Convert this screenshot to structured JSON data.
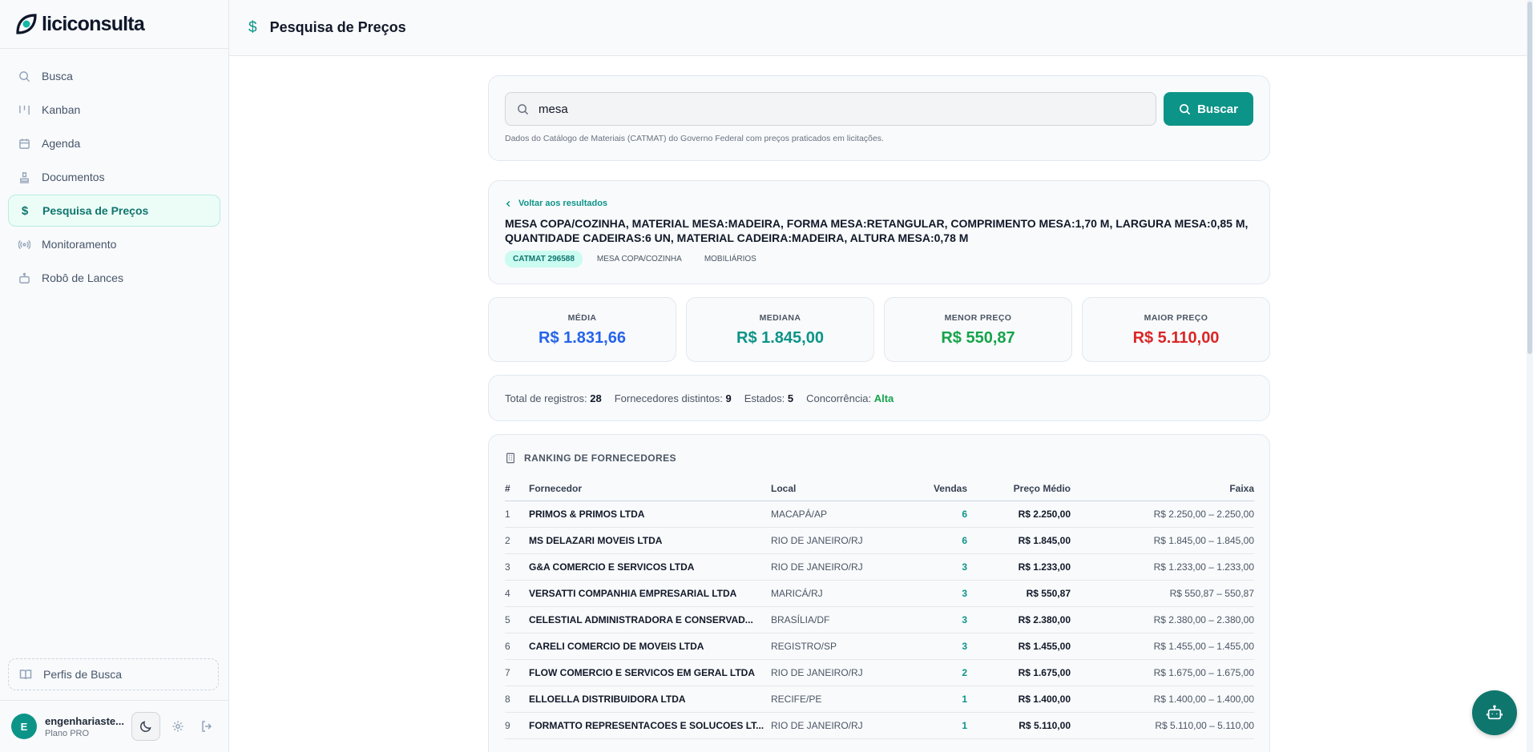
{
  "app": {
    "name": "liciconsulta"
  },
  "sidebar": {
    "items": [
      {
        "label": "Busca",
        "icon": "search-icon"
      },
      {
        "label": "Kanban",
        "icon": "kanban-icon"
      },
      {
        "label": "Agenda",
        "icon": "calendar-icon"
      },
      {
        "label": "Documentos",
        "icon": "stamp-icon"
      },
      {
        "label": "Pesquisa de Preços",
        "icon": "dollar-icon",
        "active": true
      },
      {
        "label": "Monitoramento",
        "icon": "radio-icon"
      },
      {
        "label": "Robô de Lances",
        "icon": "robot-icon"
      }
    ],
    "perfis_label": "Perfis de Busca",
    "user": {
      "initial": "E",
      "name": "engenhariaste...",
      "plan": "Plano PRO"
    }
  },
  "header": {
    "title": "Pesquisa de Preços"
  },
  "search": {
    "value": "mesa",
    "button_label": "Buscar",
    "note": "Dados do Catálogo de Materiais (CATMAT) do Governo Federal com preços praticados em licitações."
  },
  "detail": {
    "back_label": "Voltar aos resultados",
    "title": "MESA COPA/COZINHA, MATERIAL MESA:MADEIRA, FORMA MESA:RETANGULAR, COMPRIMENTO MESA:1,70 M, LARGURA MESA:0,85 M, QUANTIDADE CADEIRAS:6 UN, MATERIAL CADEIRA:MADEIRA, ALTURA MESA:0,78 M",
    "tags": {
      "code": "CATMAT 296588",
      "t1": "MESA COPA/COZINHA",
      "t2": "MOBILIÁRIOS"
    }
  },
  "stats": {
    "media": {
      "label": "MÉDIA",
      "value": "R$ 1.831,66",
      "color": "#2563eb"
    },
    "mediana": {
      "label": "MEDIANA",
      "value": "R$ 1.845,00",
      "color": "#0d9488"
    },
    "menor": {
      "label": "MENOR PREÇO",
      "value": "R$ 550,87",
      "color": "#16a34a"
    },
    "maior": {
      "label": "MAIOR PREÇO",
      "value": "R$ 5.110,00",
      "color": "#dc2626"
    }
  },
  "summary": {
    "total_label": "Total de registros:",
    "total": "28",
    "forn_label": "Fornecedores distintos:",
    "forn": "9",
    "estados_label": "Estados:",
    "estados": "5",
    "conc_label": "Concorrência:",
    "conc": "Alta"
  },
  "ranking": {
    "title": "RANKING DE FORNECEDORES",
    "columns": {
      "num": "#",
      "fornecedor": "Fornecedor",
      "local": "Local",
      "vendas": "Vendas",
      "preco": "Preço Médio",
      "faixa": "Faixa"
    },
    "rows": [
      {
        "num": "1",
        "fornecedor": "PRIMOS & PRIMOS LTDA",
        "local": "MACAPÁ/AP",
        "vendas": "6",
        "preco": "R$ 2.250,00",
        "faixa": "R$ 2.250,00 – 2.250,00"
      },
      {
        "num": "2",
        "fornecedor": "MS DELAZARI MOVEIS LTDA",
        "local": "RIO DE JANEIRO/RJ",
        "vendas": "6",
        "preco": "R$ 1.845,00",
        "faixa": "R$ 1.845,00 – 1.845,00"
      },
      {
        "num": "3",
        "fornecedor": "G&A COMERCIO E SERVICOS LTDA",
        "local": "RIO DE JANEIRO/RJ",
        "vendas": "3",
        "preco": "R$ 1.233,00",
        "faixa": "R$ 1.233,00 – 1.233,00"
      },
      {
        "num": "4",
        "fornecedor": "VERSATTI COMPANHIA EMPRESARIAL LTDA",
        "local": "MARICÁ/RJ",
        "vendas": "3",
        "preco": "R$ 550,87",
        "faixa": "R$ 550,87 – 550,87"
      },
      {
        "num": "5",
        "fornecedor": "CELESTIAL ADMINISTRADORA E CONSERVAD...",
        "local": "BRASÍLIA/DF",
        "vendas": "3",
        "preco": "R$ 2.380,00",
        "faixa": "R$ 2.380,00 – 2.380,00"
      },
      {
        "num": "6",
        "fornecedor": "CARELI COMERCIO DE MOVEIS LTDA",
        "local": "REGISTRO/SP",
        "vendas": "3",
        "preco": "R$ 1.455,00",
        "faixa": "R$ 1.455,00 – 1.455,00"
      },
      {
        "num": "7",
        "fornecedor": "FLOW COMERCIO E SERVICOS EM GERAL LTDA",
        "local": "RIO DE JANEIRO/RJ",
        "vendas": "2",
        "preco": "R$ 1.675,00",
        "faixa": "R$ 1.675,00 – 1.675,00"
      },
      {
        "num": "8",
        "fornecedor": "ELLOELLA DISTRIBUIDORA LTDA",
        "local": "RECIFE/PE",
        "vendas": "1",
        "preco": "R$ 1.400,00",
        "faixa": "R$ 1.400,00 – 1.400,00"
      },
      {
        "num": "9",
        "fornecedor": "FORMATTO REPRESENTACOES E SOLUCOES LT...",
        "local": "RIO DE JANEIRO/RJ",
        "vendas": "1",
        "preco": "R$ 5.110,00",
        "faixa": "R$ 5.110,00 – 5.110,00"
      }
    ]
  }
}
